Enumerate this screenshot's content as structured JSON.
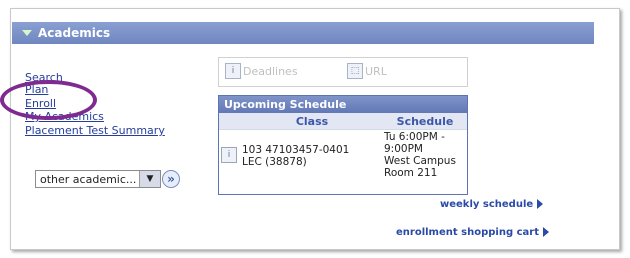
{
  "header": {
    "title": "Academics"
  },
  "left_links": [
    "Search",
    "Plan",
    "Enroll",
    "My Academics",
    "Placement Test Summary"
  ],
  "select": {
    "value": "other academic...",
    "go_label": "»"
  },
  "quick_links": [
    "Deadlines",
    "URL"
  ],
  "schedule": {
    "title": "Upcoming Schedule",
    "columns": [
      "Class",
      "Schedule"
    ],
    "row": {
      "class_line1": "103 47103457-0401",
      "class_line2": "LEC (38878)",
      "schedule_lines": [
        "Tu 6:00PM -",
        "9:00PM",
        "West Campus",
        "Room 211"
      ]
    }
  },
  "bottom_links": [
    "weekly schedule",
    "enrollment shopping cart"
  ],
  "colors": {
    "header": "#6f86c0",
    "link": "#253e9b",
    "highlight": "#7e2a91"
  }
}
